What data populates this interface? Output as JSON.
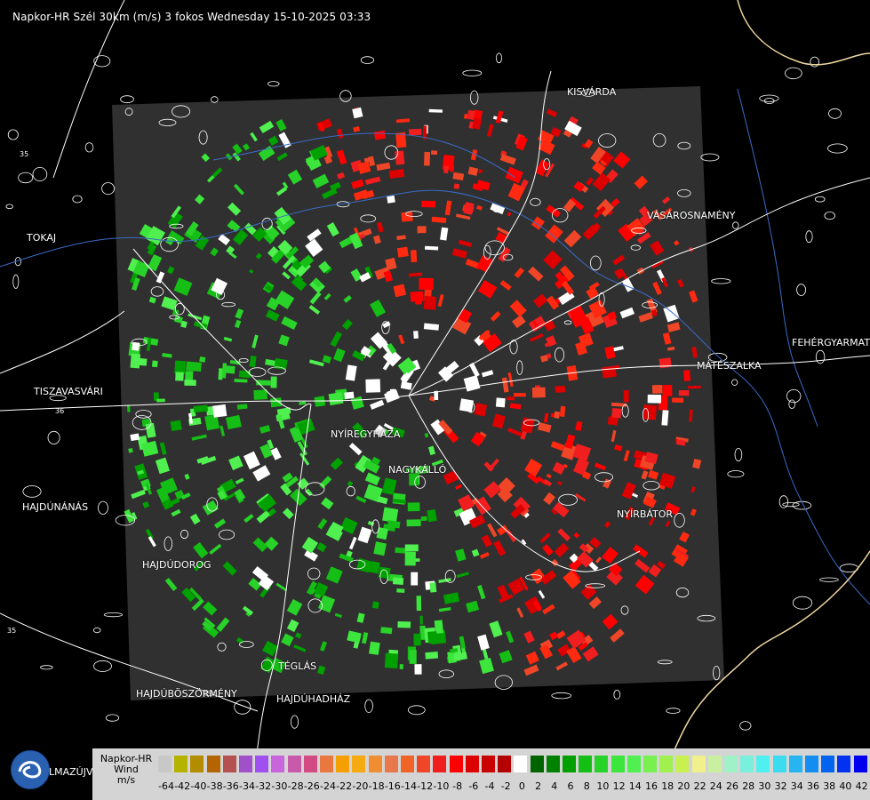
{
  "title": "Napkor-HR Szél 30km (m/s) 3 fokos Wednesday 15-10-2025 03:33",
  "places": [
    {
      "id": "kisvarda",
      "name": "KISVÁRDA"
    },
    {
      "id": "vasarosnameny",
      "name": "VÁSÁROSNAMÉNY"
    },
    {
      "id": "tokaj",
      "name": "TOKAJ"
    },
    {
      "id": "fehergyarmat",
      "name": "FEHÉRGYARMAT"
    },
    {
      "id": "mateszalka",
      "name": "MÁTÉSZALKA"
    },
    {
      "id": "tiszavasvari",
      "name": "TISZAVASVÁRI"
    },
    {
      "id": "nyiregyhaza",
      "name": "NYÍREGYHÁZA"
    },
    {
      "id": "nagykallo",
      "name": "NAGYKÁLLÓ"
    },
    {
      "id": "hajdunanas",
      "name": "HAJDÚNÁNÁS"
    },
    {
      "id": "nyirbator",
      "name": "NYÍRBÁTOR"
    },
    {
      "id": "hajdudorog",
      "name": "HAJDÚDOROG"
    },
    {
      "id": "teglas",
      "name": "TÉGLÁS"
    },
    {
      "id": "hajduboszormeny",
      "name": "HAJDÚBÖSZÖRMÉNY"
    },
    {
      "id": "hajduhadhaz",
      "name": "HAJDÚHADHÁZ"
    },
    {
      "id": "balmazujvaros",
      "name": "LMAZÚJVÁR"
    }
  ],
  "road_numbers": [
    "35",
    "36",
    "35"
  ],
  "legend": {
    "line1": "Napkor-HR",
    "line2": "Wind",
    "unit": "m/s",
    "ticks": [
      "-64",
      "-42",
      "-40",
      "-38",
      "-36",
      "-34",
      "-32",
      "-30",
      "-28",
      "-26",
      "-24",
      "-22",
      "-20",
      "-18",
      "-16",
      "-14",
      "-12",
      "-10",
      "-8",
      "-6",
      "-4",
      "-2",
      "0",
      "2",
      "4",
      "6",
      "8",
      "10",
      "12",
      "14",
      "16",
      "18",
      "20",
      "22",
      "24",
      "26",
      "28",
      "30",
      "32",
      "34",
      "36",
      "38",
      "40",
      "42"
    ],
    "colors": [
      "#c8c8c8",
      "#b4b400",
      "#b48c00",
      "#b46400",
      "#b45050",
      "#a050c8",
      "#a050f0",
      "#c864dc",
      "#c85aaa",
      "#d24b82",
      "#e87840",
      "#f5a000",
      "#f5aa14",
      "#f08c32",
      "#e8784b",
      "#f06428",
      "#f04628",
      "#f01e1e",
      "#ff0000",
      "#dc0000",
      "#c80000",
      "#b40000",
      "#ffffff",
      "#006400",
      "#008200",
      "#00a000",
      "#14be14",
      "#28d228",
      "#3ce63c",
      "#50f050",
      "#78f050",
      "#a0f050",
      "#c8f050",
      "#f0f08c",
      "#c8f0a0",
      "#a0f0c8",
      "#78f0dc",
      "#50f0f0",
      "#3cdcf0",
      "#28b4f0",
      "#148cf0",
      "#0064f0",
      "#0032f0",
      "#0000f0"
    ]
  },
  "colors": {
    "radar_area": "#303030",
    "border_line": "#f0d8a0",
    "road": "#ffffff",
    "river": "#3a6cc8",
    "legend_bg": "#d4d4d4"
  }
}
